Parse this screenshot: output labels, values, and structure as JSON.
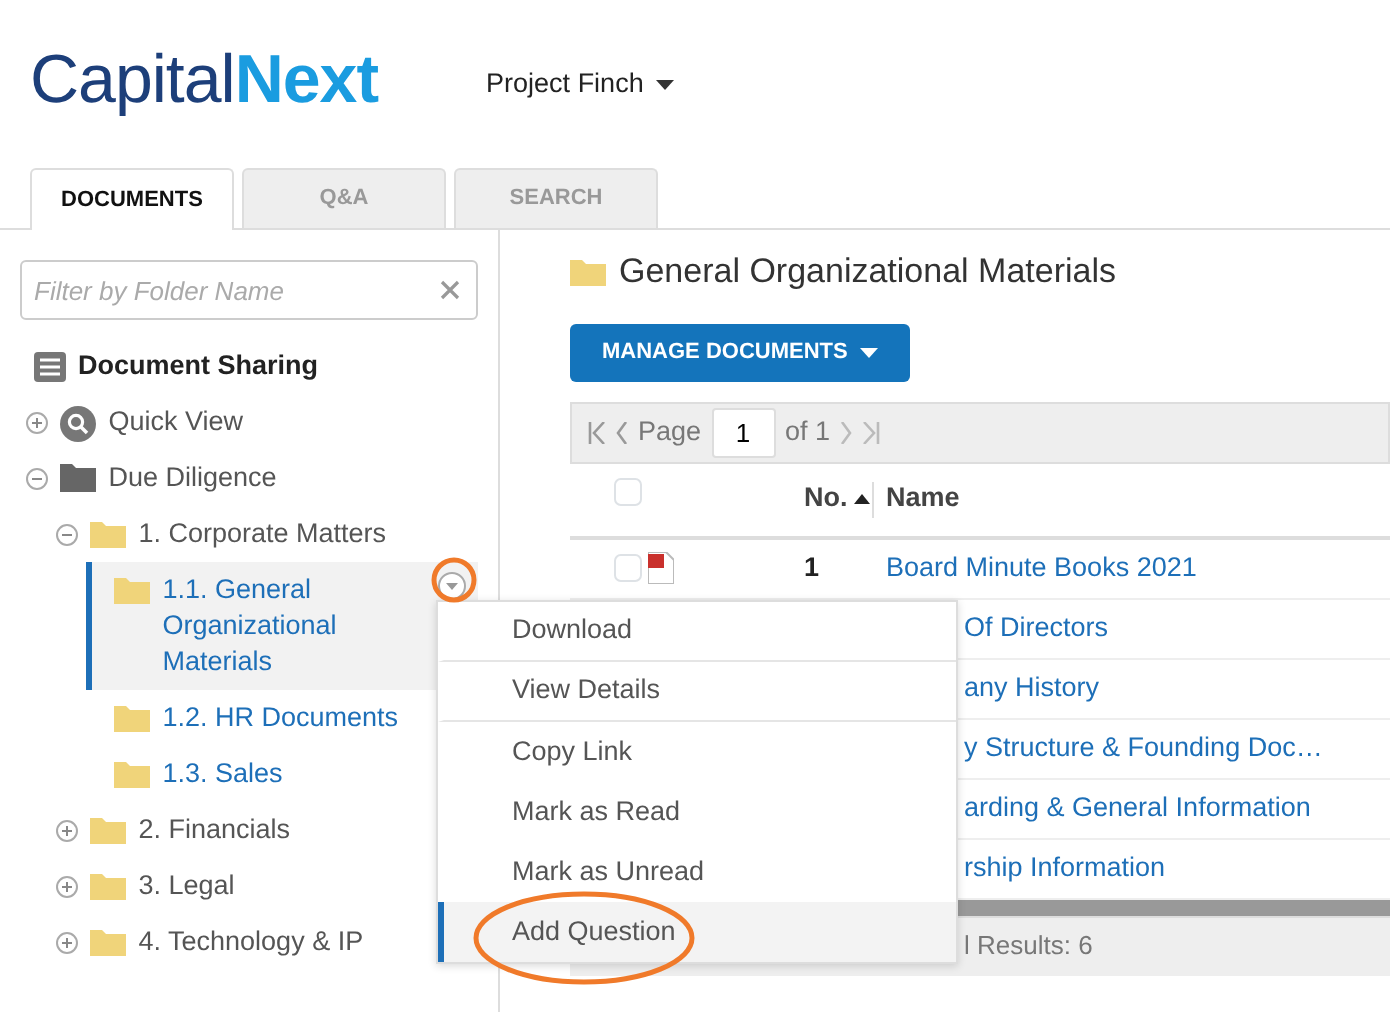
{
  "logo": "Capital**Next**",
  "project": {
    "label": "Project Finch"
  },
  "tabs": [
    {
      "label": "DOCUMENTS",
      "selected": true
    },
    {
      "label": "Q&A",
      "selected": false
    },
    {
      "label": "SEARCH",
      "selected": false
    }
  ],
  "filter": {
    "placeholder": "Filter by Folder Name"
  },
  "tree": {
    "title": "Document Sharing",
    "items": [
      {
        "label": "Quick View",
        "kind": "search",
        "expanded": false
      },
      {
        "label": "Due Diligence",
        "kind": "root-folder",
        "expanded": true,
        "children": [
          {
            "label": "1. Corporate Matters",
            "kind": "folder",
            "expanded": true,
            "selected": false,
            "children": [
              {
                "label": "1.1. General Organizational Materials",
                "kind": "folder",
                "selected": true
              },
              {
                "label": "1.2. HR Documents",
                "kind": "folder",
                "selected": false
              },
              {
                "label": "1.3. Sales",
                "kind": "folder",
                "selected": false
              }
            ]
          },
          {
            "label": "2. Financials",
            "kind": "folder",
            "expanded": false,
            "selected": false
          },
          {
            "label": "3. Legal",
            "kind": "folder",
            "expanded": false,
            "selected": false
          },
          {
            "label": "4. Technology & IP",
            "kind": "folder",
            "expanded": false,
            "selected": false
          }
        ]
      }
    ]
  },
  "content": {
    "title": "General Organizational Materials",
    "manage_button": "MANAGE DOCUMENTS",
    "pager": {
      "page_label": "Page",
      "page": "1",
      "of": "of 1"
    },
    "table": {
      "select_all": {
        "checked": false
      },
      "columns": [
        "No.",
        "Name"
      ],
      "rows": [
        {
          "checked": false,
          "no": "1",
          "name": "Board Minute Books 2021"
        },
        {
          "name": "Of Directors"
        },
        {
          "name": "any History"
        },
        {
          "name": "y Structure & Founding Doc…"
        },
        {
          "name": "arding & General Information"
        },
        {
          "name": "rship Information"
        }
      ]
    },
    "footer": "l Results: 6"
  },
  "context_menu": [
    {
      "label": "Download",
      "selected": false,
      "divider": true
    },
    {
      "label": "View Details",
      "selected": false,
      "divider": true
    },
    {
      "label": "Copy Link",
      "selected": false
    },
    {
      "label": "Mark as Read",
      "selected": false
    },
    {
      "label": "Mark as Unread",
      "selected": false
    },
    {
      "label": "Add Question",
      "selected": true
    }
  ]
}
